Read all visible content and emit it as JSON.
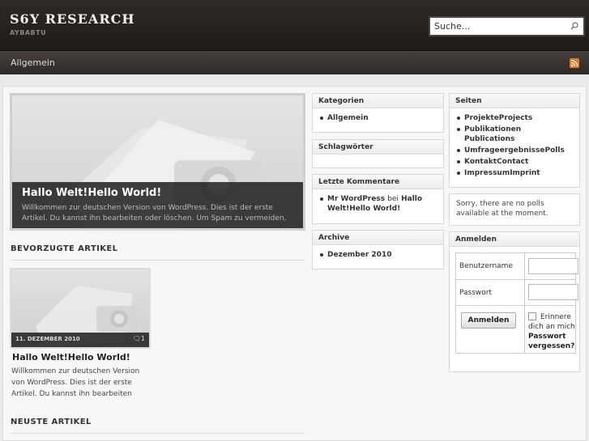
{
  "header": {
    "site_title": "S6Y RESEARCH",
    "tagline": "AYBABTU",
    "search_placeholder": "Suche..."
  },
  "nav": {
    "items": [
      "Allgemein"
    ],
    "rss_icon": "rss-icon"
  },
  "featured": {
    "title": "Hallo Welt!Hello World!",
    "excerpt": "Willkommen zur deutschen Version von WordPress. Dies ist der erste Artikel. Du kannst ihn bearbeiten oder löschen. Um Spam zu vermeiden,"
  },
  "sections": {
    "favorite_articles": "BEVORZUGTE ARTIKEL",
    "newest_articles": "NEUSTE ARTIKEL"
  },
  "card": {
    "date": "11. DEZEMBER 2010",
    "comment_count": "1",
    "title": "Hallo Welt!Hello World!",
    "excerpt": "Willkommen zur deutschen Version von WordPress. Dies ist der erste Artikel. Du kannst ihn bearbeiten"
  },
  "widgets": {
    "categories": {
      "title": "Kategorien",
      "items": [
        "Allgemein"
      ]
    },
    "tags": {
      "title": "Schlagwörter"
    },
    "recent_comments": {
      "title": "Letzte Kommentare",
      "author": "Mr WordPress",
      "connector": "bei",
      "post": "Hallo Welt!Hello World!"
    },
    "archive": {
      "title": "Archive",
      "items": [
        "Dezember 2010"
      ]
    },
    "pages": {
      "title": "Seiten",
      "items": [
        "ProjekteProjects",
        "Publikationen Publications",
        "UmfrageergebnissePolls",
        "KontaktContact",
        "ImpressumImprint"
      ]
    },
    "polls": {
      "text": "Sorry, there are no polls available at the moment."
    },
    "login": {
      "title": "Anmelden",
      "username_label": "Benutzername",
      "password_label": "Passwort",
      "button_label": "Anmelden",
      "remember_label": "Erinnere dich an mich",
      "forgot_label": "Passwort vergessen?"
    }
  }
}
